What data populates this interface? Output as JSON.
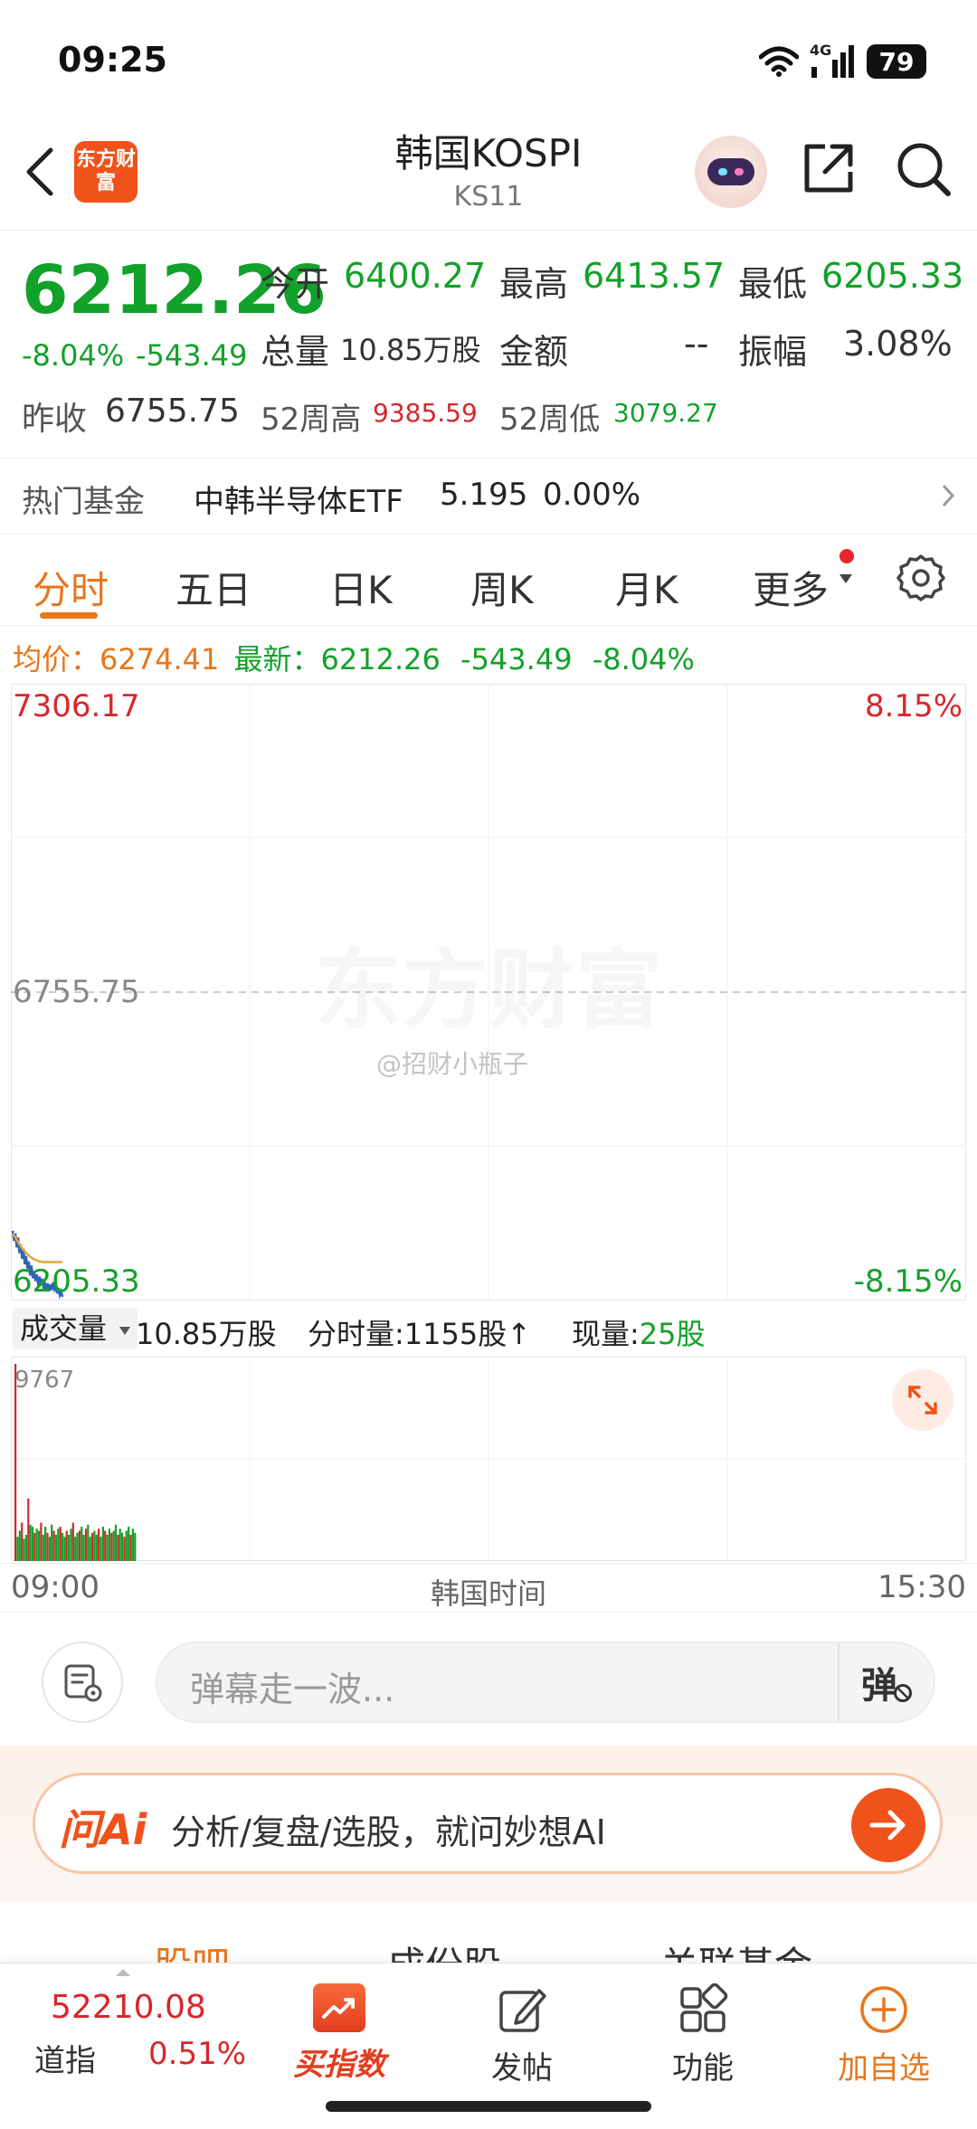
{
  "status_bar": {
    "time": "09:25",
    "network": "4G",
    "battery": "79"
  },
  "header": {
    "logo_text": "东方财富",
    "title": "韩国KOSPI",
    "code": "KS11"
  },
  "quote": {
    "price": "6212.26",
    "change_pct": "-8.04%",
    "change": "-543.49",
    "open_label": "今开",
    "open": "6400.27",
    "high_label": "最高",
    "high": "6413.57",
    "low_label": "最低",
    "low": "6205.33",
    "volume_label": "总量",
    "volume": "10.85万股",
    "amount_label": "金额",
    "amount": "--",
    "amplitude_label": "振幅",
    "amplitude": "3.08%",
    "prev_close_label": "昨收",
    "prev_close": "6755.75",
    "wk52_high_label": "52周高",
    "wk52_high": "9385.59",
    "wk52_low_label": "52周低",
    "wk52_low": "3079.27"
  },
  "hot_fund": {
    "label": "热门基金",
    "name": "中韩半导体ETF",
    "price": "5.195",
    "change": "0.00%"
  },
  "tabs": [
    "分时",
    "五日",
    "日K",
    "周K",
    "月K",
    "更多"
  ],
  "info_line": {
    "avg_label": "均价：",
    "avg": "6274.41",
    "latest_label": "最新：",
    "latest": "6212.26",
    "change": "-543.49",
    "change_pct": "-8.04%"
  },
  "chart_data": {
    "type": "line",
    "y_top": "7306.17",
    "y_mid": "6755.75",
    "y_bottom": "6205.33",
    "pct_top": "8.15%",
    "pct_bottom": "-8.15%",
    "ylim": [
      6205.33,
      7306.17
    ],
    "watermark": "东方财富",
    "credit": "@招财小瓶子",
    "series": [
      {
        "name": "最新",
        "color": "#2f66b3",
        "values": [
          6330,
          6312,
          6325,
          6300,
          6318,
          6290,
          6305,
          6280,
          6298,
          6270,
          6285,
          6262,
          6275,
          6250,
          6268,
          6245,
          6258,
          6240,
          6252,
          6232,
          6248,
          6235,
          6244,
          6226,
          6238,
          6225,
          6236,
          6222,
          6234,
          6224,
          6238,
          6225,
          6230,
          6218,
          6228,
          6215,
          6222,
          6212
        ]
      },
      {
        "name": "均价",
        "color": "#e8a33a",
        "values": [
          6325,
          6322,
          6318,
          6314,
          6310,
          6306,
          6302,
          6299,
          6296,
          6293,
          6290,
          6288,
          6286,
          6284,
          6282,
          6280,
          6279,
          6278,
          6277,
          6276,
          6275,
          6275,
          6274,
          6274,
          6274,
          6274,
          6274,
          6274,
          6274,
          6274,
          6274,
          6274,
          6274,
          6274,
          6274,
          6274,
          6274,
          6274
        ]
      }
    ]
  },
  "volume_bar": {
    "label": "成交量",
    "total": "10.85万股",
    "tick_label": "分时量:",
    "tick_value": "1155股",
    "current_label": "现量:",
    "current_value": "25股",
    "max": "9767",
    "bars": [
      9767,
      1200,
      1500,
      1900,
      1100,
      1300,
      3100,
      1800,
      1700,
      1400,
      1600,
      1500,
      1900,
      1300,
      1700,
      1400,
      1200,
      1800,
      1500,
      1300,
      1600,
      1700,
      1400,
      1200,
      1500,
      1300,
      1600,
      1900,
      1200,
      1400,
      1500,
      1700,
      1300,
      1600,
      1800,
      1200,
      1400,
      1500,
      1300,
      1600,
      1200,
      1700,
      1500,
      1300,
      1600,
      1400,
      1500,
      1800,
      1300,
      1600,
      1400,
      1200,
      1500,
      1700,
      1300,
      1600,
      1400
    ],
    "bar_colors": [
      "#12a12a",
      "#d8262c"
    ]
  },
  "time_axis": {
    "start": "09:00",
    "label": "韩国时间",
    "end": "15:30"
  },
  "comment": {
    "placeholder": "弹幕走一波...",
    "danmu_button": "弹"
  },
  "ai_banner": {
    "logo": "问Ai",
    "text": "分析/复盘/选股，就问妙想AI"
  },
  "sub_tabs": [
    "股吧",
    "成份股",
    "关联基金"
  ],
  "bottom_bar": {
    "ticker_value": "52210.08",
    "ticker_name": "道指",
    "ticker_change": "0.51%",
    "items": [
      "买指数",
      "发帖",
      "功能",
      "加自选"
    ]
  }
}
